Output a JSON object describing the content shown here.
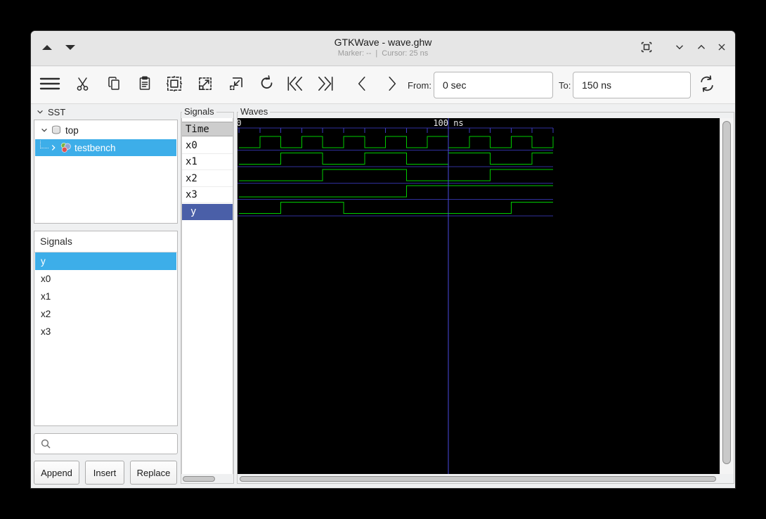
{
  "window": {
    "title": "GTKWave - wave.ghw",
    "marker_status": "Marker: --",
    "status_separator": "|",
    "cursor_status": "Cursor: 25 ns"
  },
  "toolbar": {
    "from_label": "From:",
    "from_value": "0 sec",
    "to_label": "To:",
    "to_value": "150 ns",
    "icons": [
      "menu-icon",
      "cut-icon",
      "copy-icon",
      "paste-icon",
      "zoom-fit-icon",
      "zoom-in-icon",
      "zoom-out-icon",
      "undo-icon",
      "skip-to-start-icon",
      "skip-to-end-icon",
      "prev-edge-icon",
      "next-edge-icon",
      "reload-icon"
    ]
  },
  "sst": {
    "header": "SST",
    "items": [
      {
        "label": "top",
        "icon": "module-icon",
        "expanded": true,
        "selected": false
      },
      {
        "label": "testbench",
        "icon": "package-icon",
        "expanded": false,
        "selected": true
      }
    ]
  },
  "left_signals": {
    "header": "Signals",
    "items": [
      {
        "label": "y",
        "selected": true
      },
      {
        "label": "x0",
        "selected": false
      },
      {
        "label": "x1",
        "selected": false
      },
      {
        "label": "x2",
        "selected": false
      },
      {
        "label": "x3",
        "selected": false
      }
    ],
    "buttons": [
      "Append",
      "Insert",
      "Replace"
    ]
  },
  "search": {
    "value": "",
    "placeholder": ""
  },
  "signals_panel": {
    "header": "Signals",
    "time_label": "Time",
    "selected_row": "y"
  },
  "waves_panel": {
    "header": "Waves"
  },
  "chart_data": {
    "type": "digital-waveform",
    "time_unit": "ns",
    "t_start": 0,
    "t_end": 150,
    "tick_interval_ns": 10,
    "ruler_labels": [
      {
        "t": 0,
        "label": "0"
      },
      {
        "t": 100,
        "label": "100 ns"
      }
    ],
    "cursor_line_ns": 100,
    "signals": [
      {
        "name": "x0",
        "initial": 0,
        "transitions": [
          10,
          20,
          30,
          40,
          50,
          60,
          70,
          80,
          90,
          100,
          110,
          120,
          130,
          140,
          150
        ]
      },
      {
        "name": "x1",
        "initial": 0,
        "transitions": [
          20,
          40,
          60,
          80,
          100,
          120,
          140
        ]
      },
      {
        "name": "x2",
        "initial": 0,
        "transitions": [
          40,
          80,
          120
        ]
      },
      {
        "name": "x3",
        "initial": 0,
        "transitions": [
          80
        ]
      },
      {
        "name": "y",
        "initial": 0,
        "transitions": [
          20,
          50,
          130
        ]
      }
    ]
  },
  "colors": {
    "selection_accent": "#3daee9",
    "trace_selected_bg": "#4a5fa8",
    "canvas_bg": "#000000",
    "wave_signal": "#00cc00",
    "wave_separator": "#30309c",
    "wave_tick": "#3c3cc0",
    "cursor_line": "#4a4ae0",
    "ruler_text": "#e8e8e8",
    "time_header_bg": "#cdcdcd"
  }
}
